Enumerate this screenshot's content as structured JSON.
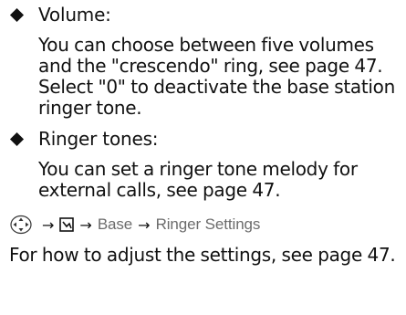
{
  "sections": [
    {
      "title": "Volume:",
      "text": "You can choose between five volumes and the \"crescendo\" ring, see page 47. Select \"0\" to deactivate the base station ringer tone."
    },
    {
      "title": "Ringer tones:",
      "text": "You can set a ringer tone melody for external calls, see page 47."
    }
  ],
  "menu_path": {
    "icons": [
      "control-key-icon",
      "settings-menu-icon"
    ],
    "arrow": "→",
    "items": [
      "Base",
      "Ringer Settings"
    ]
  },
  "note": "For how to adjust the settings, see page 47."
}
